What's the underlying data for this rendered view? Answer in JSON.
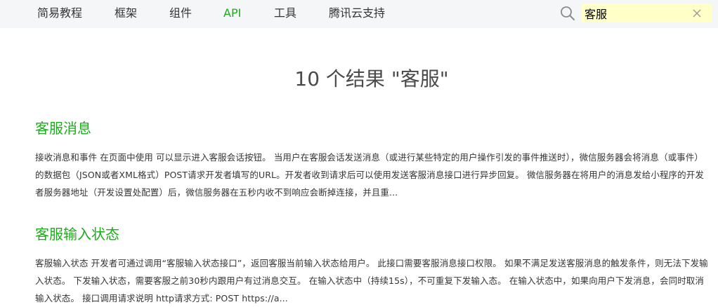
{
  "nav": {
    "items": [
      {
        "label": "简易教程",
        "active": false
      },
      {
        "label": "框架",
        "active": false
      },
      {
        "label": "组件",
        "active": false
      },
      {
        "label": "API",
        "active": true
      },
      {
        "label": "工具",
        "active": false
      },
      {
        "label": "腾讯云支持",
        "active": false
      }
    ]
  },
  "search": {
    "value": "客服",
    "search_icon": "search-icon",
    "clear_icon": "close-icon"
  },
  "results": {
    "summary": "10 个结果 \"客服\"",
    "items": [
      {
        "title": "客服消息",
        "snippet": "接收消息和事件 在页面中使用 可以显示进入客服会话按钮。 当用户在客服会话发送消息（或进行某些特定的用户操作引发的事件推送时），微信服务器会将消息（或事件）的数据包（JSON或者XML格式）POST请求开发者填写的URL。开发者收到请求后可以使用发送客服消息接口进行异步回复。 微信服务器在将用户的消息发给小程序的开发者服务器地址（开发设置处配置）后，微信服务器在五秒内收不到响应会断掉连接，并且重..."
      },
      {
        "title": "客服输入状态",
        "snippet": "客服输入状态 开发者可通过调用“客服输入状态接口”，返回客服当前输入状态给用户。 此接口需要客服消息接口权限。 如果不满足发送客服消息的触发条件，则无法下发输入状态。 下发输入状态，需要客服之前30秒内跟用户有过消息交互。 在输入状态中（持续15s），不可重复下发输入态。 在输入状态中，如果向用户下发消息，会同时取消输入状态。 接口调用请求说明 http请求方式: POST https://a..."
      }
    ]
  },
  "colors": {
    "accent": "#1aad19",
    "topbar_bg": "#f5f6f7",
    "search_bg": "#ffffc8"
  }
}
